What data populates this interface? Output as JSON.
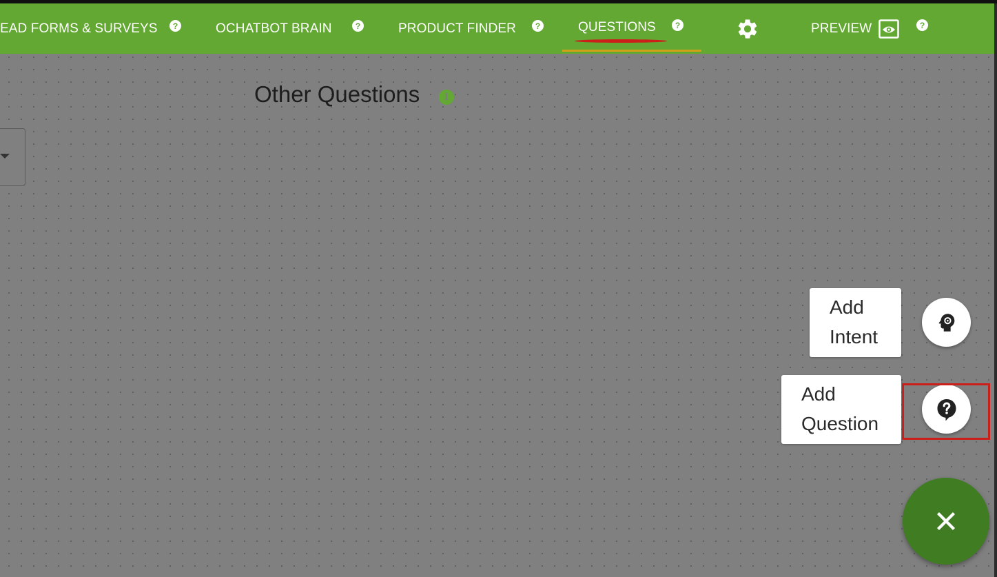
{
  "nav": {
    "items": [
      {
        "label": "EAD FORMS & SURVEYS",
        "help": "?"
      },
      {
        "label": "OCHATBOT BRAIN",
        "help": "?"
      },
      {
        "label": "PRODUCT FINDER",
        "help": "?"
      },
      {
        "label": "QUESTIONS",
        "help": "?",
        "active": true
      },
      {
        "label": "PREVIEW",
        "help": "?"
      }
    ],
    "settings_icon": "gear-icon",
    "preview_icon": "eye-icon"
  },
  "main": {
    "section_title": "Other Questions",
    "info_icon": "info-icon",
    "info_glyph": "i"
  },
  "fab": {
    "actions": [
      {
        "label_line1": "Add",
        "label_line2": "Intent",
        "icon": "brain-gear-icon"
      },
      {
        "label_line1": "Add",
        "label_line2": "Question",
        "icon": "question-bubble-icon"
      }
    ],
    "close_icon": "close-icon"
  },
  "colors": {
    "nav_bg": "#62a832",
    "fab_main": "#3f7c22",
    "highlight": "#cc1f1a",
    "overlay": "#808080"
  }
}
